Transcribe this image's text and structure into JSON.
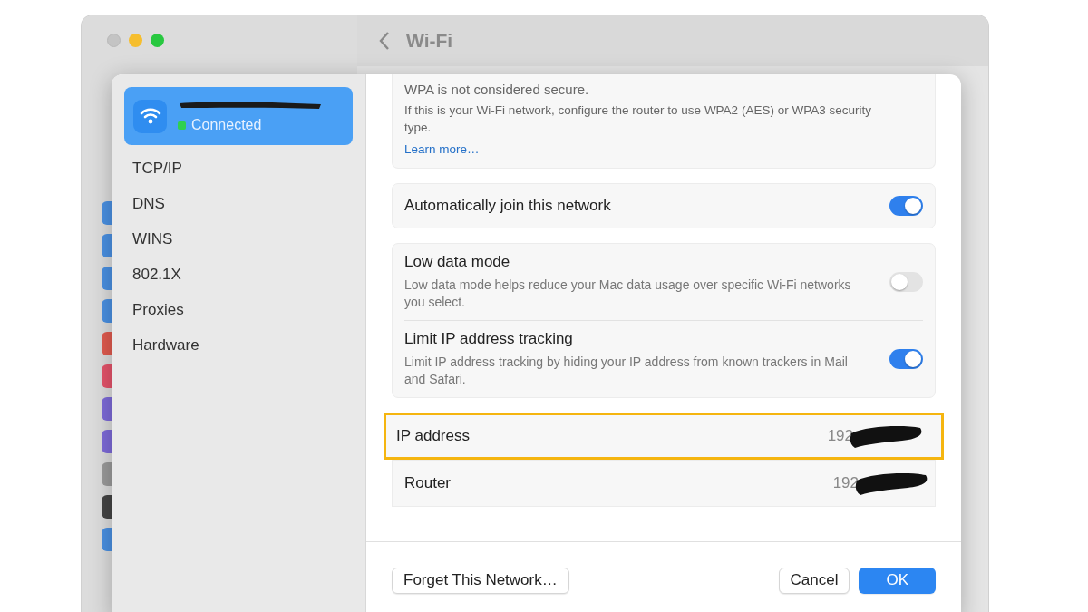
{
  "window": {
    "title": "Wi-Fi"
  },
  "sidebar": {
    "items": [
      {
        "kind": "network",
        "status": "Connected",
        "selected": true
      },
      {
        "kind": "section",
        "label": "TCP/IP",
        "selected": false
      },
      {
        "kind": "section",
        "label": "DNS",
        "selected": false
      },
      {
        "kind": "section",
        "label": "WINS",
        "selected": false
      },
      {
        "kind": "section",
        "label": "802.1X",
        "selected": false
      },
      {
        "kind": "section",
        "label": "Proxies",
        "selected": false
      },
      {
        "kind": "section",
        "label": "Hardware",
        "selected": false
      }
    ]
  },
  "warning": {
    "heading": "WPA is not considered secure.",
    "text": "If this is your Wi-Fi network, configure the router to use WPA2 (AES) or WPA3 security type.",
    "link": "Learn more…"
  },
  "toggle_groups": [
    [
      {
        "label": "Automatically join this network",
        "on": true
      }
    ],
    [
      {
        "label": "Low data mode",
        "description": "Low data mode helps reduce your Mac data usage over specific Wi-Fi networks you select.",
        "on": false
      },
      {
        "label": "Limit IP address tracking",
        "description": "Limit IP address tracking by hiding your IP address from known trackers in Mail and Safari.",
        "on": true
      }
    ]
  ],
  "info_rows": [
    {
      "label": "IP address",
      "value": "192",
      "highlighted": true
    },
    {
      "label": "Router",
      "value": "192",
      "highlighted": false
    }
  ],
  "buttons": [
    {
      "label": "Forget This Network…",
      "kind": "default"
    },
    {
      "label": "Cancel",
      "kind": "default"
    },
    {
      "label": "OK",
      "kind": "primary"
    }
  ]
}
